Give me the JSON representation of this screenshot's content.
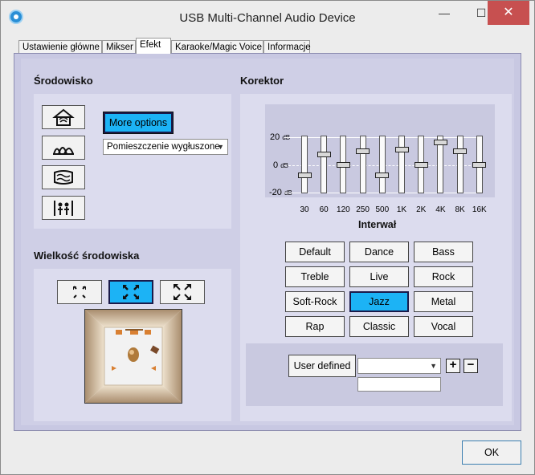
{
  "window": {
    "title": "USB Multi-Channel Audio Device",
    "min_glyph": "—",
    "max_glyph": "☐",
    "close_glyph": "✕"
  },
  "tabs": [
    {
      "label": "Ustawienie główne"
    },
    {
      "label": "Mikser"
    },
    {
      "label": "Efekt"
    },
    {
      "label": "Karaoke/Magic Voice"
    },
    {
      "label": "Informacje"
    }
  ],
  "active_tab": "Efekt",
  "environment": {
    "heading": "Środowisko",
    "more_options_label": "More options",
    "selected_environment": "Pomieszczenie wygłuszone",
    "env_icons": [
      "room-house-icon",
      "opera-house-icon",
      "underwater-icon",
      "concert-crowd-icon"
    ]
  },
  "env_size": {
    "heading": "Wielkość środowiska",
    "size_icons": [
      "small-size-icon",
      "medium-size-icon",
      "large-size-icon"
    ],
    "active_index": 1
  },
  "equalizer": {
    "heading": "Korektor",
    "axis_top": "20",
    "axis_mid": "0",
    "axis_bottom": "-20",
    "unit": "dB",
    "interval_label": "Interwał",
    "range": [
      -20,
      20
    ],
    "bands": [
      {
        "label": "30",
        "value": -9
      },
      {
        "label": "60",
        "value": 8
      },
      {
        "label": "120",
        "value": 0
      },
      {
        "label": "250",
        "value": 11
      },
      {
        "label": "500",
        "value": -9
      },
      {
        "label": "1K",
        "value": 12
      },
      {
        "label": "2K",
        "value": 0
      },
      {
        "label": "4K",
        "value": 18
      },
      {
        "label": "8K",
        "value": 11
      },
      {
        "label": "16K",
        "value": 0
      }
    ]
  },
  "presets": [
    {
      "label": "Default"
    },
    {
      "label": "Dance"
    },
    {
      "label": "Bass"
    },
    {
      "label": "Treble"
    },
    {
      "label": "Live"
    },
    {
      "label": "Rock"
    },
    {
      "label": "Soft-Rock"
    },
    {
      "label": "Jazz"
    },
    {
      "label": "Metal"
    },
    {
      "label": "Rap"
    },
    {
      "label": "Classic"
    },
    {
      "label": "Vocal"
    }
  ],
  "active_preset": "Jazz",
  "user": {
    "defined_label": "User defined",
    "add_label": "+",
    "remove_label": "−",
    "selected_value": "",
    "name_value": ""
  },
  "footer": {
    "ok_label": "OK"
  },
  "colors": {
    "accent": "#1cb3f5",
    "close": "#c75050"
  }
}
